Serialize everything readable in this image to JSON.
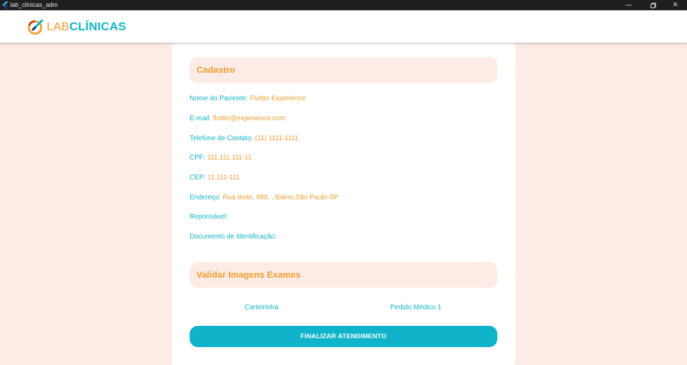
{
  "window": {
    "title": "lab_clinicas_adm",
    "controls": [
      "minimize",
      "restore",
      "close"
    ]
  },
  "brand": {
    "part1": "LAB",
    "part2": "CLÍNICAS",
    "primary_color": "#0fb4cb",
    "accent_color": "#f49d2f",
    "background_color": "#fdece6"
  },
  "cadastro": {
    "title": "Cadastro",
    "fields": {
      "nome": {
        "label": "Nome do Paciente: ",
        "value": "Flutter Experience"
      },
      "email": {
        "label": "E-mail: ",
        "value": "flutter@experience.com"
      },
      "telefone": {
        "label": "Telefone de Contato: ",
        "value": "(11) 1111-1111"
      },
      "cpf": {
        "label": "CPF: ",
        "value": "111.111.111-11"
      },
      "cep": {
        "label": "CEP: ",
        "value": "11.111-111"
      },
      "endereco": {
        "label": "Endereço: ",
        "value": "Rua teste, 999, , Bairro,São Paulo-SP"
      },
      "responsavel": {
        "label": "Reponsável: ",
        "value": ""
      },
      "documento": {
        "label": "Documento de Identificação: ",
        "value": ""
      }
    }
  },
  "validar": {
    "title": "Validar Imagens Exames",
    "items": [
      "Carteirinha",
      "Pedido Médico 1"
    ]
  },
  "finalizar_label": "FINALIZAR ATENDIMENTO"
}
